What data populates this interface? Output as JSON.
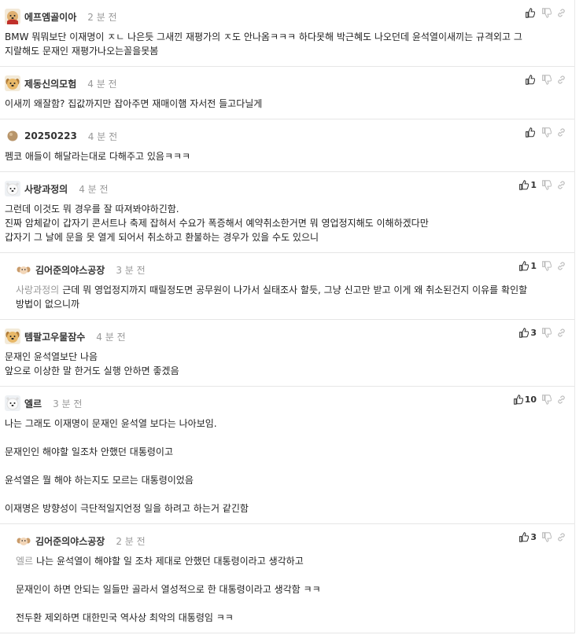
{
  "comments": [
    {
      "user": "에프엠골이아",
      "time": "2 분 전",
      "likes": "",
      "avatar": "dog-mask",
      "reply": false,
      "mention": "",
      "lines": [
        "BMW 뭐뭐보단 이재명이 ㅈㄴ 나은듯 그새낀 재평가의 ㅈ도 안나옴ㅋㅋㅋ 하다못해 박근혜도 나오던데 윤석열이새끼는 규격외고 그",
        "지랄해도 문재인 재평가나오는꼴을못봄"
      ]
    },
    {
      "user": "제동신의모험",
      "time": "4 분 전",
      "likes": "",
      "avatar": "dog",
      "reply": false,
      "mention": "",
      "lines": [
        "이새끼 왜잘함? 집값까지만 잡아주면 재매이햄 자서전 들고다닐게"
      ]
    },
    {
      "user": "20250223",
      "time": "4 분 전",
      "likes": "",
      "avatar": "ball",
      "reply": false,
      "mention": "",
      "lines": [
        "펨코 애들이 해달라는대로 다해주고 있음ㅋㅋㅋ"
      ]
    },
    {
      "user": "사랑과정의",
      "time": "4 분 전",
      "likes": "1",
      "avatar": "white-dog",
      "reply": false,
      "mention": "",
      "lines": [
        "그런데 이것도 뭐 경우를 잘 따져봐야하긴함.",
        "진짜 암체같이 갑자기 콘서트나 축제 잡혀서 수요가 폭증해서 예약취소한거면 뭐 영업정지해도 이해하겠다만",
        "갑자기 그 날에 문을 못 열게 되어서 취소하고 환불하는 경우가 있을 수도 있으니"
      ]
    },
    {
      "user": "김어준의야스공장",
      "time": "3 분 전",
      "likes": "1",
      "avatar": "pup",
      "reply": true,
      "mention": "사랑과정의",
      "lines": [
        "근데 뭐 영업정지까지 때릴정도면 공무원이 나가서 실태조사 할듯, 그냥 신고만 받고 이게 왜 취소된건지 이유를 확인할",
        "방법이 없으니까"
      ]
    },
    {
      "user": "템팔고우물잠수",
      "time": "4 분 전",
      "likes": "3",
      "avatar": "dog",
      "reply": false,
      "mention": "",
      "lines": [
        "문재인 윤석열보단 나음",
        "앞으로 이상한 말 한거도 실행 안하면 좋겠음"
      ]
    },
    {
      "user": "엘르",
      "time": "3 분 전",
      "likes": "10",
      "avatar": "white-dog",
      "reply": false,
      "mention": "",
      "lines": [
        "나는 그래도 이재명이 문재인 윤석열 보다는 나아보임.",
        "",
        "문재인인 해야할 일조차 안했던 대통령이고",
        "",
        "윤석열은 뭘 해야 하는지도 모르는 대통령이었음",
        "",
        "이재명은 방향성이 극단적일지언정 일을 하려고 하는거 같긴함"
      ]
    },
    {
      "user": "김어준의야스공장",
      "time": "2 분 전",
      "likes": "3",
      "avatar": "pup",
      "reply": true,
      "mention": "엘르",
      "lines": [
        "나는 윤석열이 해야할 일 조차 제대로 안했던 대통령이라고 생각하고",
        "",
        "문재인이 하면 안되는 일들만 골라서 열성적으로 한 대통령이라고 생각함 ㅋㅋ",
        "",
        "전두환 제외하면 대한민국 역사상 최악의 대통령임 ㅋㅋ"
      ]
    }
  ]
}
